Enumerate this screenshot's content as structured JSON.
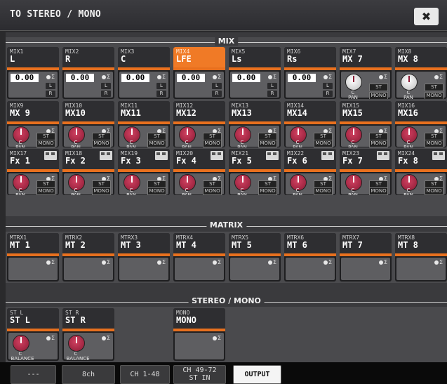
{
  "window": {
    "title": "TO STEREO / MONO",
    "close_glyph": "✖"
  },
  "sections": {
    "mix": "MIX",
    "matrix": "MATRIX",
    "stereo_mono": "STEREO / MONO"
  },
  "mix_row1": [
    {
      "name": "MIX1",
      "label": "L",
      "value": "0.00",
      "btn": "L",
      "btn2": "R",
      "selected": false
    },
    {
      "name": "MIX2",
      "label": "R",
      "value": "0.00",
      "btn": "L",
      "btn2": "R",
      "selected": false
    },
    {
      "name": "MIX3",
      "label": "C",
      "value": "0.00",
      "btn": "L",
      "btn2": "R",
      "selected": false
    },
    {
      "name": "MIX4",
      "label": "LFE",
      "value": "0.00",
      "btn": "L",
      "btn2": "R",
      "selected": true
    },
    {
      "name": "MIX5",
      "label": "Ls",
      "value": "0.00",
      "btn": "L",
      "btn2": "R",
      "selected": false
    },
    {
      "name": "MIX6",
      "label": "Rs",
      "value": "0.00",
      "btn": "L",
      "btn2": "R",
      "selected": false
    }
  ],
  "mix_row1_pan": [
    {
      "name": "MIX7",
      "label": "MX 7",
      "pan": "C",
      "pan_label": "PAN",
      "st": "ST",
      "mono": "MONO"
    },
    {
      "name": "MIX8",
      "label": "MX 8",
      "pan": "C",
      "pan_label": "PAN",
      "st": "ST",
      "mono": "MONO"
    }
  ],
  "mix_row2": [
    {
      "name": "MIX9",
      "label": "MX 9"
    },
    {
      "name": "MIX10",
      "label": "MX10"
    },
    {
      "name": "MIX11",
      "label": "MX11"
    },
    {
      "name": "MIX12",
      "label": "MX12"
    },
    {
      "name": "MIX13",
      "label": "MX13"
    },
    {
      "name": "MIX14",
      "label": "MX14"
    },
    {
      "name": "MIX15",
      "label": "MX15"
    },
    {
      "name": "MIX16",
      "label": "MX16"
    }
  ],
  "mix_row3": [
    {
      "name": "MIX17",
      "label": "Fx 1"
    },
    {
      "name": "MIX18",
      "label": "Fx 2"
    },
    {
      "name": "MIX19",
      "label": "Fx 3"
    },
    {
      "name": "MIX20",
      "label": "Fx 4"
    },
    {
      "name": "MIX21",
      "label": "Fx 5"
    },
    {
      "name": "MIX22",
      "label": "Fx 6"
    },
    {
      "name": "MIX23",
      "label": "Fx 7"
    },
    {
      "name": "MIX24",
      "label": "Fx 8"
    }
  ],
  "pan_common": {
    "pan": "C",
    "pan_label": "PAN",
    "st": "ST",
    "mono": "MONO",
    "sigma": "Σ"
  },
  "matrix": [
    {
      "name": "MTRX1",
      "label": "MT 1"
    },
    {
      "name": "MTRX2",
      "label": "MT 2"
    },
    {
      "name": "MTRX3",
      "label": "MT 3"
    },
    {
      "name": "MTRX4",
      "label": "MT 4"
    },
    {
      "name": "MTRX5",
      "label": "MT 5"
    },
    {
      "name": "MTRX6",
      "label": "MT 6"
    },
    {
      "name": "MTRX7",
      "label": "MT 7"
    },
    {
      "name": "MTRX8",
      "label": "MT 8"
    }
  ],
  "stereo": [
    {
      "name": "ST L",
      "label": "ST L",
      "pan": "C",
      "pan_label": "BALANCE"
    },
    {
      "name": "ST R",
      "label": "ST R",
      "pan": "C",
      "pan_label": "BALANCE"
    }
  ],
  "mono": {
    "name": "MONO",
    "label": "MONO"
  },
  "tabs": [
    {
      "label": "---",
      "active": false
    },
    {
      "label": "8ch",
      "active": false
    },
    {
      "label": "CH 1-48",
      "active": false
    },
    {
      "label": "CH 49-72\nST IN",
      "active": false
    },
    {
      "label": "OUTPUT",
      "active": true
    }
  ],
  "colors": {
    "selected_header": "#f07a26",
    "accent_bar": "#e8701e",
    "knob": "#b02848"
  }
}
